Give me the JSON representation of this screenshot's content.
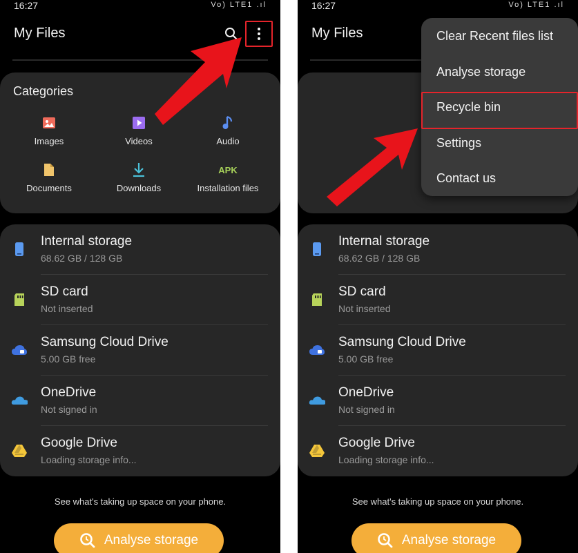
{
  "status_time": "16:27",
  "status_indicators": "Vo) LTE1 .ıl",
  "app_title": "My Files",
  "categories": {
    "title": "Categories",
    "items": [
      {
        "label": "Images",
        "icon": "image-icon",
        "color": "#ef6b5b"
      },
      {
        "label": "Videos",
        "icon": "video-icon",
        "color": "#9b6cf0"
      },
      {
        "label": "Audio",
        "icon": "music-note-icon",
        "color": "#5b8ef0"
      },
      {
        "label": "Documents",
        "icon": "document-icon",
        "color": "#f0c46b"
      },
      {
        "label": "Downloads",
        "icon": "download-icon",
        "color": "#4bc1d9"
      },
      {
        "label": "Installation files",
        "icon": "apk-icon",
        "icon_text": "APK",
        "color": "#a8d25a"
      }
    ]
  },
  "storage": [
    {
      "name": "Internal storage",
      "detail": "68.62 GB / 128 GB",
      "icon": "phone-icon",
      "color": "#5b9af0"
    },
    {
      "name": "SD card",
      "detail": "Not inserted",
      "icon": "sd-card-icon",
      "color": "#b7d35a"
    },
    {
      "name": "Samsung Cloud Drive",
      "detail": "5.00 GB free",
      "icon": "samsung-cloud-icon",
      "color": "#3f72e0"
    },
    {
      "name": "OneDrive",
      "detail": "Not signed in",
      "icon": "onedrive-icon",
      "color": "#3f9be0"
    },
    {
      "name": "Google Drive",
      "detail": "Loading storage info...",
      "icon": "google-drive-icon",
      "color": "#f4c63a"
    }
  ],
  "footer_text": "See what's taking up space on your phone.",
  "analyse_button": "Analyse storage",
  "menu": {
    "items": [
      "Clear Recent files list",
      "Analyse storage",
      "Recycle bin",
      "Settings",
      "Contact us"
    ],
    "highlighted": "Recycle bin"
  },
  "colors": {
    "accent_button": "#f4ae3a",
    "highlight_red": "#e5242b",
    "card_bg": "#272727",
    "menu_bg": "#3a3a3a"
  }
}
